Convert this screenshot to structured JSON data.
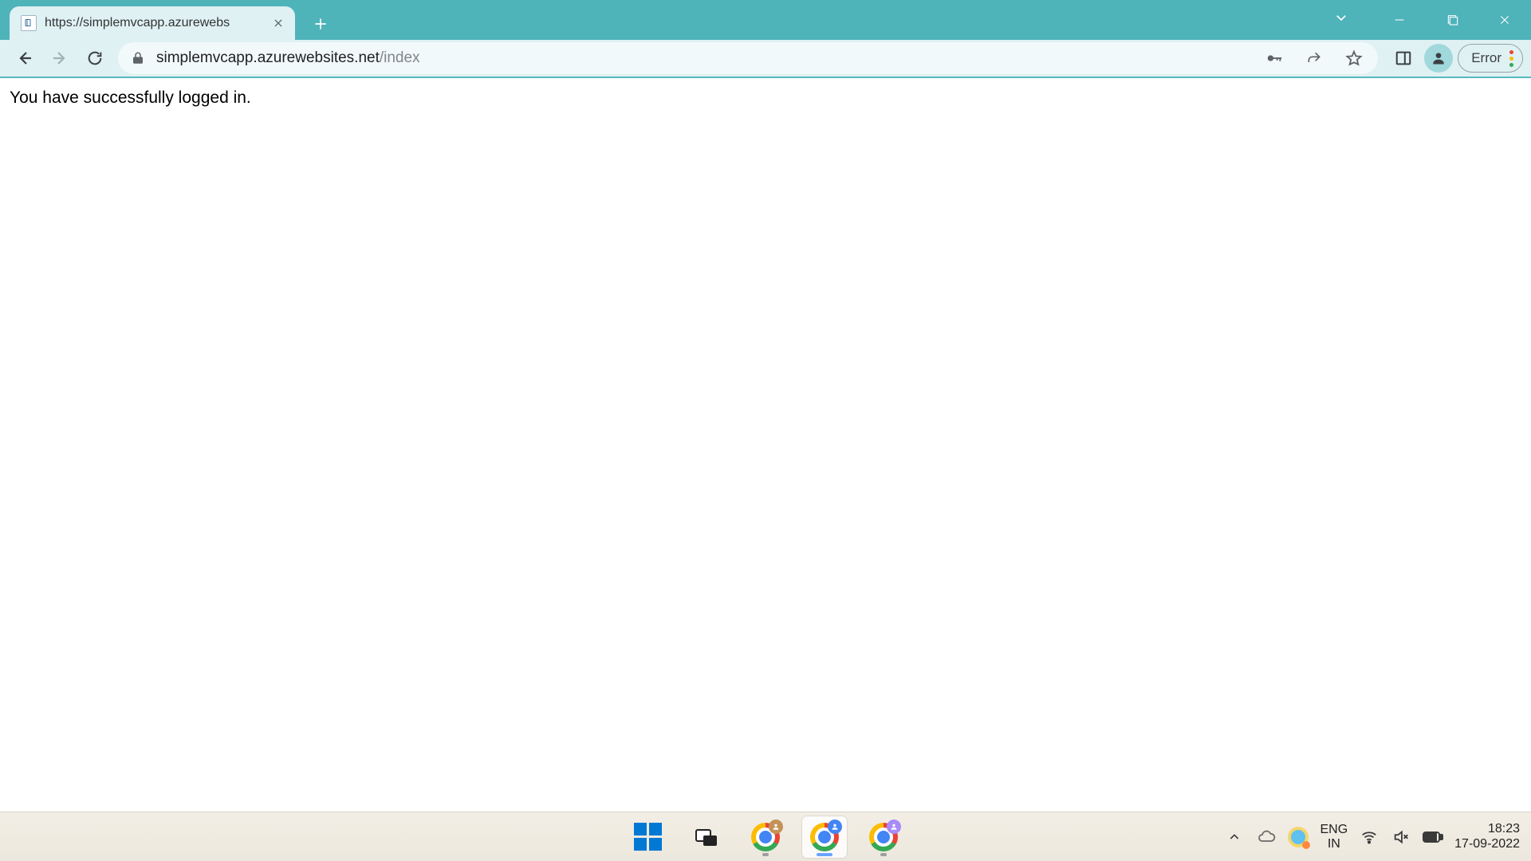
{
  "browser": {
    "tab": {
      "title": "https://simplemvcapp.azurewebs"
    },
    "url_domain": "simplemvcapp.azurewebsites.net",
    "url_path": "/index",
    "error_chip": "Error"
  },
  "page": {
    "message": "You have successfully logged in."
  },
  "taskbar": {
    "lang_top": "ENG",
    "lang_bottom": "IN",
    "time": "18:23",
    "date": "17-09-2022"
  }
}
